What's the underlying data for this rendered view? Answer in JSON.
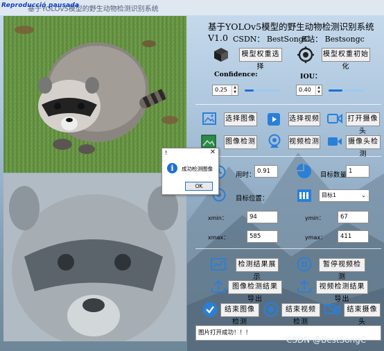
{
  "window": {
    "title": "基于YOLOv5模型的野生动物检测识别系统",
    "recording_label": "Reproducció pausada"
  },
  "header": {
    "title": "基于YOLOv5模型的野生动物检测识别系统V1.0",
    "csdn": "CSDN：  BestSongC",
    "bilibili": "B站：  Bestsongc"
  },
  "model": {
    "select_weights": "模型权重选择",
    "init_weights": "模型权重初始化"
  },
  "params": {
    "confidence_label": "Confidence:",
    "confidence_value": "0.25",
    "confidence_fraction": 0.25,
    "iou_label": "IOU：",
    "iou_value": "0.40",
    "iou_fraction": 0.4
  },
  "actions": {
    "select_image": "选择图像",
    "select_video": "选择视频",
    "open_camera": "打开摄像头",
    "image_detect": "图像检测",
    "video_detect": "视频检测",
    "camera_detect": "摄像头检测"
  },
  "results": {
    "time_label": "用时：",
    "time_value": "0.91",
    "count_label": "目标数量：",
    "count_value": "1",
    "position_label": "目标位置：",
    "target_select": "目标1",
    "xmin_label": "xmin：",
    "xmin_value": "94",
    "ymin_label": "ymin：",
    "ymin_value": "67",
    "xmax_label": "xmax：",
    "xmax_value": "585",
    "ymax_label": "ymax：",
    "ymax_value": "411"
  },
  "bottom": {
    "show_results": "检测结果展示",
    "pause_video": "暂停视频检测",
    "export_image": "图像检测结果导出",
    "export_video": "视频检测结果导出",
    "end_image": "结束图像检测",
    "end_video": "结束视频检测",
    "end_camera": "结束摄像头"
  },
  "status": {
    "text": "图片打开成功！！！"
  },
  "watermark": "CSDN @BestSongC",
  "dialog": {
    "title": "!",
    "close": "✕",
    "message": "成功检测图像",
    "ok": "OK"
  },
  "colors": {
    "accent": "#1b6fd6",
    "icon_blue": "#2a7fd8"
  }
}
